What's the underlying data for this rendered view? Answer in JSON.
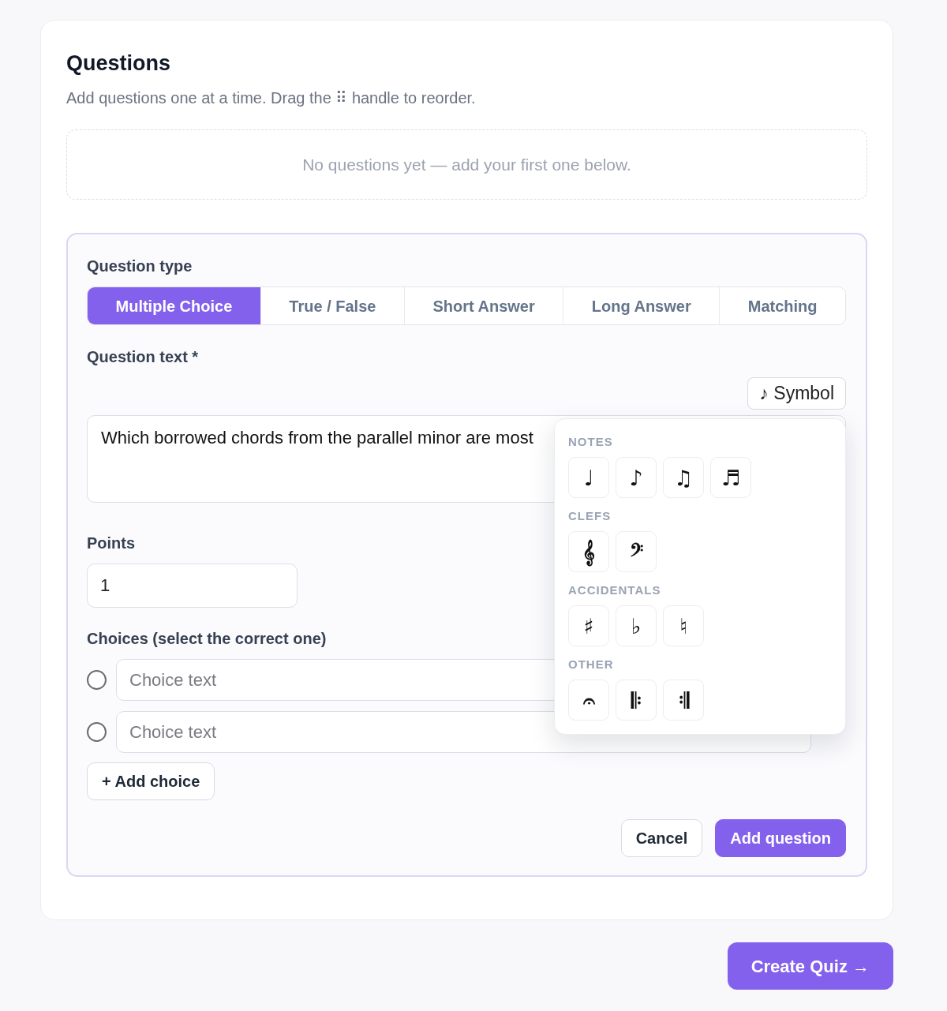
{
  "section": {
    "title": "Questions",
    "subtitle": "Add questions one at a time. Drag the ⠿ handle to reorder."
  },
  "empty_state": {
    "text": "No questions yet — add your first one below."
  },
  "editor": {
    "type_label": "Question type",
    "types": [
      {
        "label": "Multiple Choice",
        "selected": true
      },
      {
        "label": "True / False",
        "selected": false
      },
      {
        "label": "Short Answer",
        "selected": false
      },
      {
        "label": "Long Answer",
        "selected": false
      },
      {
        "label": "Matching",
        "selected": false
      }
    ],
    "question_label": "Question text *",
    "symbol_button": "♪ Symbol",
    "question_text": {
      "value": "Which borrowed chords from the parallel minor are most"
    },
    "symbol_menu": {
      "open": true,
      "groups": [
        {
          "title": "NOTES",
          "symbols": [
            "♩",
            "♪",
            "♫",
            "♬"
          ]
        },
        {
          "title": "CLEFS",
          "symbols": [
            "𝄞",
            "𝄢"
          ]
        },
        {
          "title": "ACCIDENTALS",
          "symbols": [
            "♯",
            "♭",
            "♮"
          ]
        },
        {
          "title": "OTHER",
          "symbols": [
            "𝄐",
            "𝄆",
            "𝄇"
          ]
        }
      ]
    },
    "points_label": "Points",
    "points": {
      "value": "1"
    },
    "choices_label": "Choices (select the correct one)",
    "choices": [
      {
        "placeholder": "Choice text",
        "selected": false
      },
      {
        "placeholder": "Choice text",
        "selected": false
      }
    ],
    "add_choice": "+ Add choice",
    "actions": [
      {
        "label": "Cancel",
        "kind": "secondary"
      },
      {
        "label": "Add question",
        "kind": "primary"
      }
    ]
  },
  "create_button": "Create Quiz →"
}
